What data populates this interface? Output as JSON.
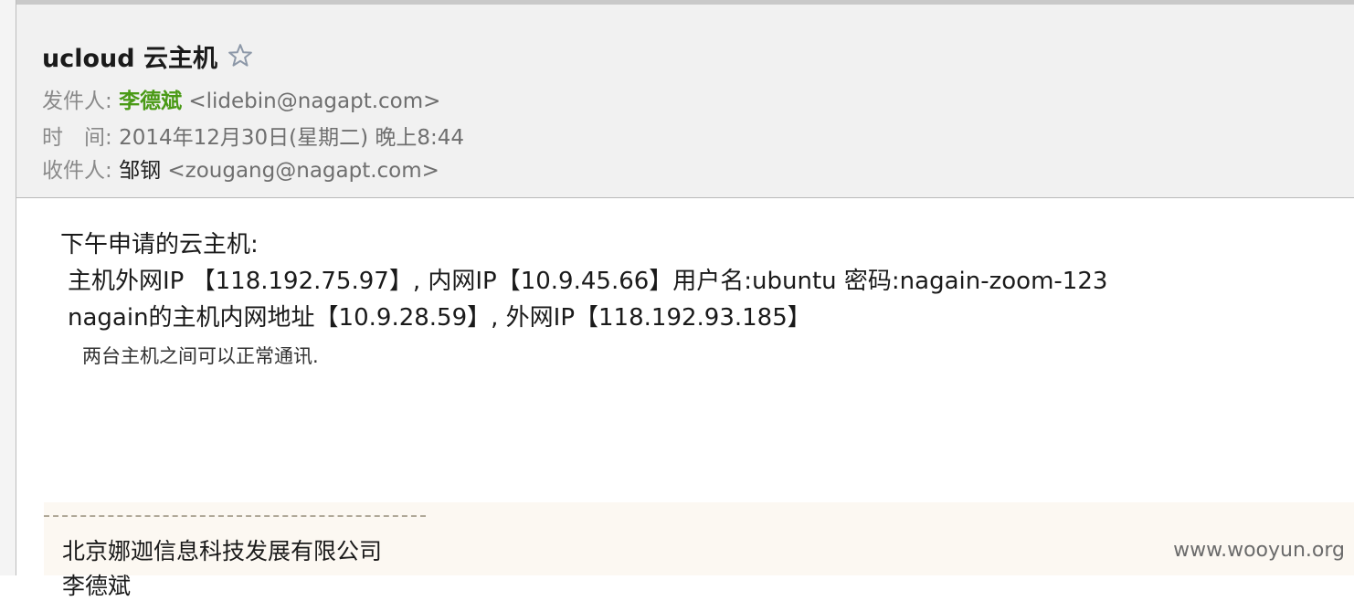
{
  "email": {
    "subject": "ucloud 云主机",
    "from_label": "发件人:",
    "from_name": "李德斌",
    "from_address": "<lidebin@nagapt.com>",
    "time_label": "时　间:",
    "time_value": "2014年12月30日(星期二) 晚上8:44",
    "to_label": "收件人:",
    "to_name": "邹钢",
    "to_address": "<zougang@nagapt.com>"
  },
  "body": {
    "line1": "下午申请的云主机:",
    "line2": "主机外网IP 【118.192.75.97】, 内网IP【10.9.45.66】用户名:ubuntu 密码:nagain-zoom-123",
    "line3": "nagain的主机内网地址【10.9.28.59】, 外网IP【118.192.93.185】",
    "line4": "两台主机之间可以正常通讯."
  },
  "signature": {
    "company": "北京娜迦信息科技发展有限公司",
    "name": "李德斌"
  },
  "watermark": "www.wooyun.org",
  "icons": {
    "star": "star-outline-icon"
  },
  "colors": {
    "sender_name": "#4a9a16",
    "header_bg": "#f1f1f1",
    "signature_bg": "#fcf8f2"
  }
}
